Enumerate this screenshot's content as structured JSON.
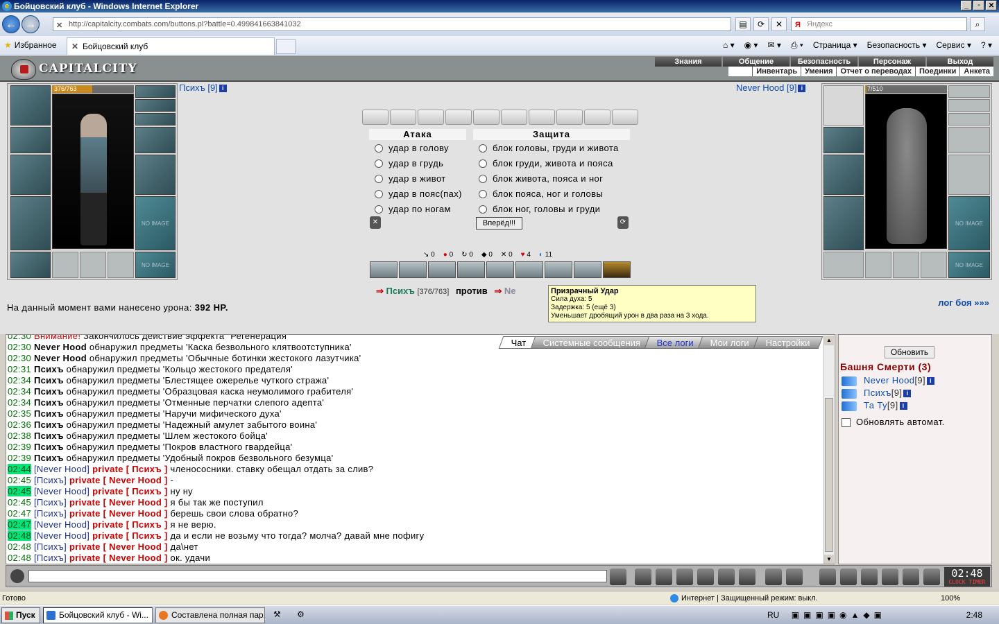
{
  "window": {
    "title": "Бойцовский клуб - Windows Internet Explorer"
  },
  "browser": {
    "url": "http://capitalcity.combats.com/buttons.pl?battle=0.499841663841032",
    "search_placeholder": "Яндекс",
    "favorites_label": "Избранное",
    "tab_title": "Бойцовский клуб",
    "commands": [
      "Страница ▾",
      "Безопасность ▾",
      "Сервис ▾"
    ]
  },
  "game_header": {
    "logo": "CAPITALCITY",
    "menu_top": [
      "Знания",
      "Общение",
      "Безопасность",
      "Персонаж",
      "Выход"
    ],
    "menu_bottom": [
      "Инвентарь",
      "Умения",
      "Отчет о переводах",
      "Поединки",
      "Анкета"
    ]
  },
  "player_left": {
    "name": "Психъ [9]",
    "hp": "376/763",
    "hp_fraction": 0.49
  },
  "player_right": {
    "name": "Never Hood [9]",
    "hp": "7/510",
    "hp_fraction": 0.014
  },
  "slot_noimg": "NO IMAGE",
  "attack": {
    "title": "Атака",
    "options": [
      "удар в голову",
      "удар в грудь",
      "удар в живот",
      "удар в пояс(пах)",
      "удар по ногам"
    ]
  },
  "defense": {
    "title": "Защита",
    "options": [
      "блок головы, груди и живота",
      "блок груди, живота и пояса",
      "блок живота, пояса и ног",
      "блок пояса, ног и головы",
      "блок ног, головы и груди"
    ]
  },
  "go_button": "Вперёд!!!",
  "stats": [
    "0",
    "0",
    "0",
    "0",
    "0",
    "4",
    "11"
  ],
  "vs": {
    "p1": "Психъ",
    "p1_hp": "[376/763]",
    "vs_word": "против",
    "p2_partial": "Ne"
  },
  "tooltip": {
    "title": "Призрачный Удар",
    "line1": "Сила духа: 5",
    "line2": "Задержка: 5 (ещё 3)",
    "line3": "Уменьшает дробящий урон в два раза на 3 хода."
  },
  "damage": {
    "prefix": "На данный момент вами нанесено урона:",
    "value": "392 HP."
  },
  "log_link": "лог боя »»»",
  "chat_tabs": [
    "Чат",
    "Системные сообщения",
    "Все логи",
    "Мои логи",
    "Настройки"
  ],
  "chat": {
    "partial_line": {
      "time": "02:30",
      "warn": "Внимание!",
      "text": " Закончилось действие эффекта \"Регенерация\""
    },
    "system_lines": [
      {
        "time": "02:30",
        "nick": "Never Hood",
        "text": " обнаружил предметы 'Каска безвольного клятвоотступника'"
      },
      {
        "time": "02:30",
        "nick": "Never Hood",
        "text": " обнаружил предметы 'Обычные ботинки жестокого лазутчика'"
      },
      {
        "time": "02:31",
        "nick": "Психъ",
        "text": " обнаружил предметы 'Кольцо жестокого предателя'"
      },
      {
        "time": "02:34",
        "nick": "Психъ",
        "text": " обнаружил предметы 'Блестящее ожерелье чуткого стража'"
      },
      {
        "time": "02:34",
        "nick": "Психъ",
        "text": " обнаружил предметы 'Образцовая каска неумолимого грабителя'"
      },
      {
        "time": "02:34",
        "nick": "Психъ",
        "text": " обнаружил предметы 'Отменные перчатки слепого адепта'"
      },
      {
        "time": "02:35",
        "nick": "Психъ",
        "text": " обнаружил предметы 'Наручи мифического духа'"
      },
      {
        "time": "02:36",
        "nick": "Психъ",
        "text": " обнаружил предметы 'Надежный амулет забытого воина'"
      },
      {
        "time": "02:38",
        "nick": "Психъ",
        "text": " обнаружил предметы 'Шлем жестокого бойца'"
      },
      {
        "time": "02:39",
        "nick": "Психъ",
        "text": " обнаружил предметы 'Покров властного гвардейца'"
      },
      {
        "time": "02:39",
        "nick": "Психъ",
        "text": " обнаружил предметы 'Удобный покров безвольного безумца'"
      }
    ],
    "private_lines": [
      {
        "time": "02:44",
        "hl": true,
        "from": "[Never Hood]",
        "to": "private [ Психъ ]",
        "text": " членососники. ставку обещал отдать за слив?"
      },
      {
        "time": "02:45",
        "hl": false,
        "from": "[Психъ]",
        "to": "private [ Never Hood ]",
        "text": " -"
      },
      {
        "time": "02:45",
        "hl": true,
        "from": "[Never Hood]",
        "to": "private [ Психъ ]",
        "text": " ну ну"
      },
      {
        "time": "02:45",
        "hl": false,
        "from": "[Психъ]",
        "to": "private [ Never Hood ]",
        "text": " я бы так же поступил"
      },
      {
        "time": "02:47",
        "hl": false,
        "from": "[Психъ]",
        "to": "private [ Never Hood ]",
        "text": " берешь свои слова обратно?"
      },
      {
        "time": "02:47",
        "hl": true,
        "from": "[Never Hood]",
        "to": "private [ Психъ ]",
        "text": " я не верю."
      },
      {
        "time": "02:48",
        "hl": true,
        "from": "[Never Hood]",
        "to": "private [ Психъ ]",
        "text": " да и если не возьму что тогда? молча? давай мне пофигу"
      },
      {
        "time": "02:48",
        "hl": false,
        "from": "[Психъ]",
        "to": "private [ Never Hood ]",
        "text": " да\\нет"
      },
      {
        "time": "02:48",
        "hl": false,
        "from": "[Психъ]",
        "to": "private [ Never Hood ]",
        "text": " ок. удачи"
      }
    ]
  },
  "sidebar": {
    "refresh": "Обновить",
    "tower": "Башня Смерти (3)",
    "players": [
      {
        "name": "Never Hood",
        "lvl": "[9]"
      },
      {
        "name": "Психъ",
        "lvl": "[9]"
      },
      {
        "name": "Та Ту",
        "lvl": "[9]"
      }
    ],
    "auto": "Обновлять автомат."
  },
  "clock": {
    "time": "02:48",
    "sub": "CLOCK TIMER"
  },
  "statusbar": {
    "left": "Готово",
    "zone": "Интернет | Защищенный режим: выкл.",
    "zoom": "100%"
  },
  "taskbar": {
    "start": "Пуск",
    "items": [
      "Бойцовский клуб - Wi...",
      "Составлена полная пар..."
    ],
    "lang": "RU",
    "time": "2:48"
  }
}
